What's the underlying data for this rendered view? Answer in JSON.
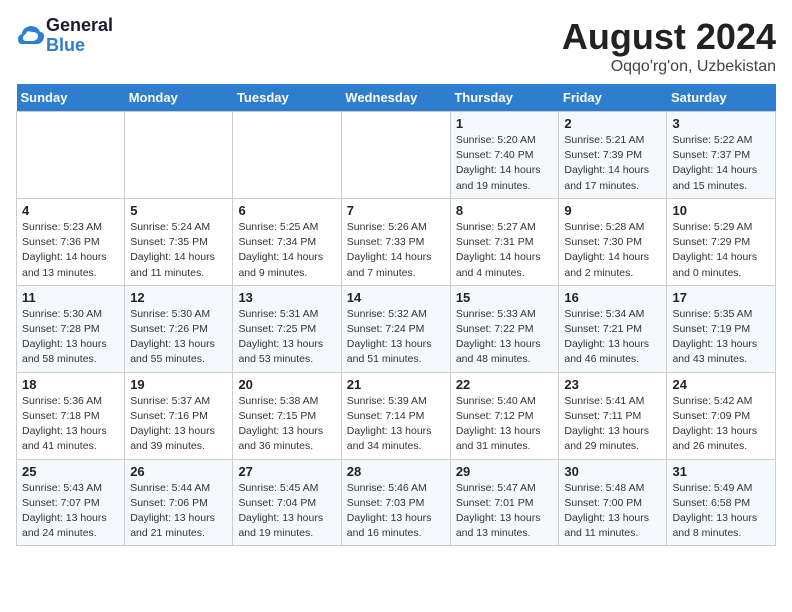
{
  "header": {
    "logo_line1": "General",
    "logo_line2": "Blue",
    "month_year": "August 2024",
    "location": "Oqqo'rg'on, Uzbekistan"
  },
  "weekdays": [
    "Sunday",
    "Monday",
    "Tuesday",
    "Wednesday",
    "Thursday",
    "Friday",
    "Saturday"
  ],
  "weeks": [
    [
      {
        "day": "",
        "info": ""
      },
      {
        "day": "",
        "info": ""
      },
      {
        "day": "",
        "info": ""
      },
      {
        "day": "",
        "info": ""
      },
      {
        "day": "1",
        "info": "Sunrise: 5:20 AM\nSunset: 7:40 PM\nDaylight: 14 hours\nand 19 minutes."
      },
      {
        "day": "2",
        "info": "Sunrise: 5:21 AM\nSunset: 7:39 PM\nDaylight: 14 hours\nand 17 minutes."
      },
      {
        "day": "3",
        "info": "Sunrise: 5:22 AM\nSunset: 7:37 PM\nDaylight: 14 hours\nand 15 minutes."
      }
    ],
    [
      {
        "day": "4",
        "info": "Sunrise: 5:23 AM\nSunset: 7:36 PM\nDaylight: 14 hours\nand 13 minutes."
      },
      {
        "day": "5",
        "info": "Sunrise: 5:24 AM\nSunset: 7:35 PM\nDaylight: 14 hours\nand 11 minutes."
      },
      {
        "day": "6",
        "info": "Sunrise: 5:25 AM\nSunset: 7:34 PM\nDaylight: 14 hours\nand 9 minutes."
      },
      {
        "day": "7",
        "info": "Sunrise: 5:26 AM\nSunset: 7:33 PM\nDaylight: 14 hours\nand 7 minutes."
      },
      {
        "day": "8",
        "info": "Sunrise: 5:27 AM\nSunset: 7:31 PM\nDaylight: 14 hours\nand 4 minutes."
      },
      {
        "day": "9",
        "info": "Sunrise: 5:28 AM\nSunset: 7:30 PM\nDaylight: 14 hours\nand 2 minutes."
      },
      {
        "day": "10",
        "info": "Sunrise: 5:29 AM\nSunset: 7:29 PM\nDaylight: 14 hours\nand 0 minutes."
      }
    ],
    [
      {
        "day": "11",
        "info": "Sunrise: 5:30 AM\nSunset: 7:28 PM\nDaylight: 13 hours\nand 58 minutes."
      },
      {
        "day": "12",
        "info": "Sunrise: 5:30 AM\nSunset: 7:26 PM\nDaylight: 13 hours\nand 55 minutes."
      },
      {
        "day": "13",
        "info": "Sunrise: 5:31 AM\nSunset: 7:25 PM\nDaylight: 13 hours\nand 53 minutes."
      },
      {
        "day": "14",
        "info": "Sunrise: 5:32 AM\nSunset: 7:24 PM\nDaylight: 13 hours\nand 51 minutes."
      },
      {
        "day": "15",
        "info": "Sunrise: 5:33 AM\nSunset: 7:22 PM\nDaylight: 13 hours\nand 48 minutes."
      },
      {
        "day": "16",
        "info": "Sunrise: 5:34 AM\nSunset: 7:21 PM\nDaylight: 13 hours\nand 46 minutes."
      },
      {
        "day": "17",
        "info": "Sunrise: 5:35 AM\nSunset: 7:19 PM\nDaylight: 13 hours\nand 43 minutes."
      }
    ],
    [
      {
        "day": "18",
        "info": "Sunrise: 5:36 AM\nSunset: 7:18 PM\nDaylight: 13 hours\nand 41 minutes."
      },
      {
        "day": "19",
        "info": "Sunrise: 5:37 AM\nSunset: 7:16 PM\nDaylight: 13 hours\nand 39 minutes."
      },
      {
        "day": "20",
        "info": "Sunrise: 5:38 AM\nSunset: 7:15 PM\nDaylight: 13 hours\nand 36 minutes."
      },
      {
        "day": "21",
        "info": "Sunrise: 5:39 AM\nSunset: 7:14 PM\nDaylight: 13 hours\nand 34 minutes."
      },
      {
        "day": "22",
        "info": "Sunrise: 5:40 AM\nSunset: 7:12 PM\nDaylight: 13 hours\nand 31 minutes."
      },
      {
        "day": "23",
        "info": "Sunrise: 5:41 AM\nSunset: 7:11 PM\nDaylight: 13 hours\nand 29 minutes."
      },
      {
        "day": "24",
        "info": "Sunrise: 5:42 AM\nSunset: 7:09 PM\nDaylight: 13 hours\nand 26 minutes."
      }
    ],
    [
      {
        "day": "25",
        "info": "Sunrise: 5:43 AM\nSunset: 7:07 PM\nDaylight: 13 hours\nand 24 minutes."
      },
      {
        "day": "26",
        "info": "Sunrise: 5:44 AM\nSunset: 7:06 PM\nDaylight: 13 hours\nand 21 minutes."
      },
      {
        "day": "27",
        "info": "Sunrise: 5:45 AM\nSunset: 7:04 PM\nDaylight: 13 hours\nand 19 minutes."
      },
      {
        "day": "28",
        "info": "Sunrise: 5:46 AM\nSunset: 7:03 PM\nDaylight: 13 hours\nand 16 minutes."
      },
      {
        "day": "29",
        "info": "Sunrise: 5:47 AM\nSunset: 7:01 PM\nDaylight: 13 hours\nand 13 minutes."
      },
      {
        "day": "30",
        "info": "Sunrise: 5:48 AM\nSunset: 7:00 PM\nDaylight: 13 hours\nand 11 minutes."
      },
      {
        "day": "31",
        "info": "Sunrise: 5:49 AM\nSunset: 6:58 PM\nDaylight: 13 hours\nand 8 minutes."
      }
    ]
  ]
}
